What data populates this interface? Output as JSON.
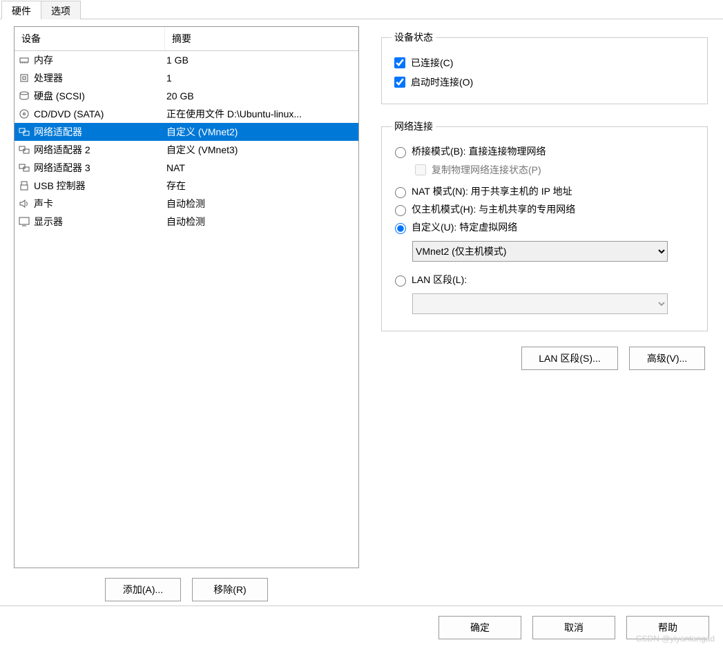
{
  "tabs": {
    "hardware": "硬件",
    "options": "选项"
  },
  "device_list": {
    "header_device": "设备",
    "header_summary": "摘要",
    "items": [
      {
        "icon": "memory",
        "name": "内存",
        "summary": "1 GB",
        "selected": false
      },
      {
        "icon": "cpu",
        "name": "处理器",
        "summary": "1",
        "selected": false
      },
      {
        "icon": "disk",
        "name": "硬盘 (SCSI)",
        "summary": "20 GB",
        "selected": false
      },
      {
        "icon": "cd",
        "name": "CD/DVD (SATA)",
        "summary": "正在使用文件 D:\\Ubuntu-linux...",
        "selected": false
      },
      {
        "icon": "net",
        "name": "网络适配器",
        "summary": "自定义 (VMnet2)",
        "selected": true
      },
      {
        "icon": "net",
        "name": "网络适配器 2",
        "summary": "自定义 (VMnet3)",
        "selected": false
      },
      {
        "icon": "net",
        "name": "网络适配器 3",
        "summary": "NAT",
        "selected": false
      },
      {
        "icon": "usb",
        "name": "USB 控制器",
        "summary": "存在",
        "selected": false
      },
      {
        "icon": "sound",
        "name": "声卡",
        "summary": "自动检测",
        "selected": false
      },
      {
        "icon": "display",
        "name": "显示器",
        "summary": "自动检测",
        "selected": false
      }
    ]
  },
  "left_buttons": {
    "add": "添加(A)...",
    "remove": "移除(R)"
  },
  "device_status": {
    "legend": "设备状态",
    "connected": {
      "label": "已连接(C)",
      "checked": true
    },
    "connect_at_power": {
      "label": "启动时连接(O)",
      "checked": true
    }
  },
  "net_connection": {
    "legend": "网络连接",
    "bridged": {
      "label": "桥接模式(B): 直接连接物理网络",
      "checked": false
    },
    "replicate": {
      "label": "复制物理网络连接状态(P)",
      "checked": false,
      "disabled": true
    },
    "nat": {
      "label": "NAT 模式(N): 用于共享主机的 IP 地址",
      "checked": false
    },
    "hostonly": {
      "label": "仅主机模式(H): 与主机共享的专用网络",
      "checked": false
    },
    "custom": {
      "label": "自定义(U): 特定虚拟网络",
      "checked": true
    },
    "custom_select": "VMnet2 (仅主机模式)",
    "lan": {
      "label": "LAN 区段(L):",
      "checked": false
    },
    "lan_select": ""
  },
  "right_buttons": {
    "lan_segments": "LAN 区段(S)...",
    "advanced": "高级(V)..."
  },
  "footer": {
    "ok": "确定",
    "cancel": "取消",
    "help": "帮助"
  },
  "watermark": "CSDN @yiyantangad"
}
